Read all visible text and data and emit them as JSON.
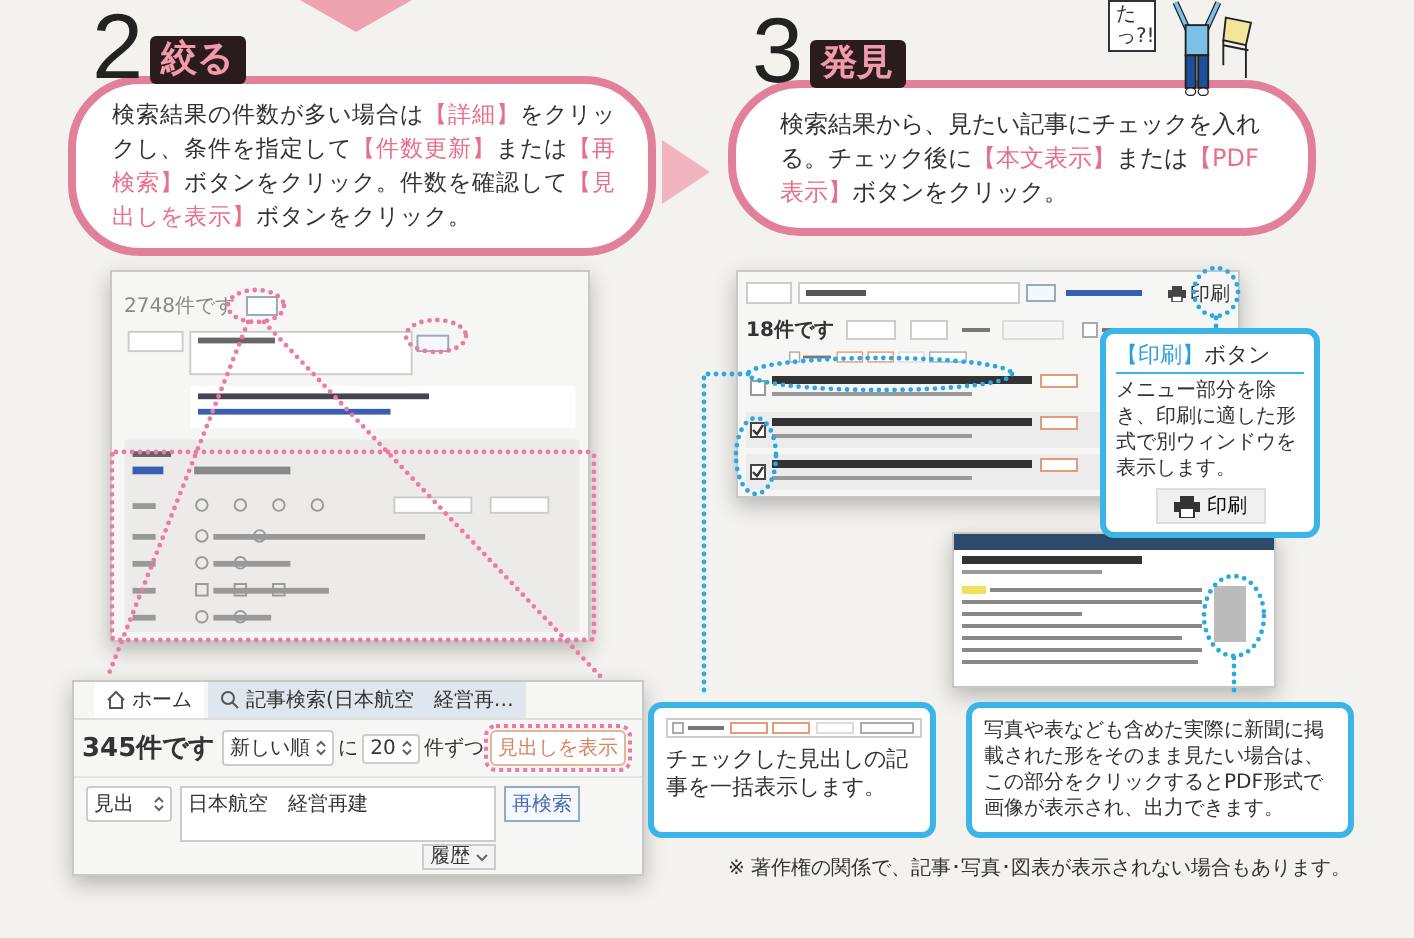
{
  "step2": {
    "number": "2",
    "title": "絞る",
    "text": "検索結果の件数が多い場合は**【詳細】**をクリックし、条件を指定して**【件数更新】**または**【再検索】**ボタンをクリック。件数を確認して**【見出しを表示】**ボタンをクリック。"
  },
  "step3": {
    "number": "3",
    "title": "発見",
    "text": "検索結果から、見たい記事にチェックを入れる。チェック後に**【本文表示】**または**【PDF表示】**ボタンをクリック。"
  },
  "illustration": {
    "speech": "たっ?!"
  },
  "search_screen": {
    "result_count": "2748件です"
  },
  "detail_screen": {
    "tabs": [
      {
        "label": "ホーム",
        "selected": false
      },
      {
        "label": "記事検索(日本航空　経営再…",
        "selected": true
      }
    ],
    "result_count": "345件です",
    "sort": "新しい順",
    "per_label": "に",
    "per_page": "20",
    "per_unit": "件ずつ",
    "show_headlines_button": "見出しを表示",
    "field_select": "見出",
    "query": "日本航空　経営再建",
    "search_button": "再検索",
    "history": "履歴"
  },
  "results_screen": {
    "result_count": "18件です",
    "print_button": "印刷",
    "articles": [
      {
        "checked": false
      },
      {
        "checked": true
      },
      {
        "checked": true
      }
    ]
  },
  "print_callout": {
    "title": "**【印刷】**ボタン",
    "text": "メニュー部分を除き、印刷に適した形式で別ウィンドウを表示します。",
    "button": "印刷"
  },
  "check_callout": {
    "text": "チェックした見出しの記事を一括表示します。"
  },
  "pdf_callout": {
    "text": "写真や表なども含めた実際に新聞に掲載された形をそのまま見たい場合は、この部分をクリックするとPDF形式で画像が表示され、出力できます。"
  },
  "footnote": "※ 著作権の関係で、記事･写真･図表が表示されない場合もあります。"
}
